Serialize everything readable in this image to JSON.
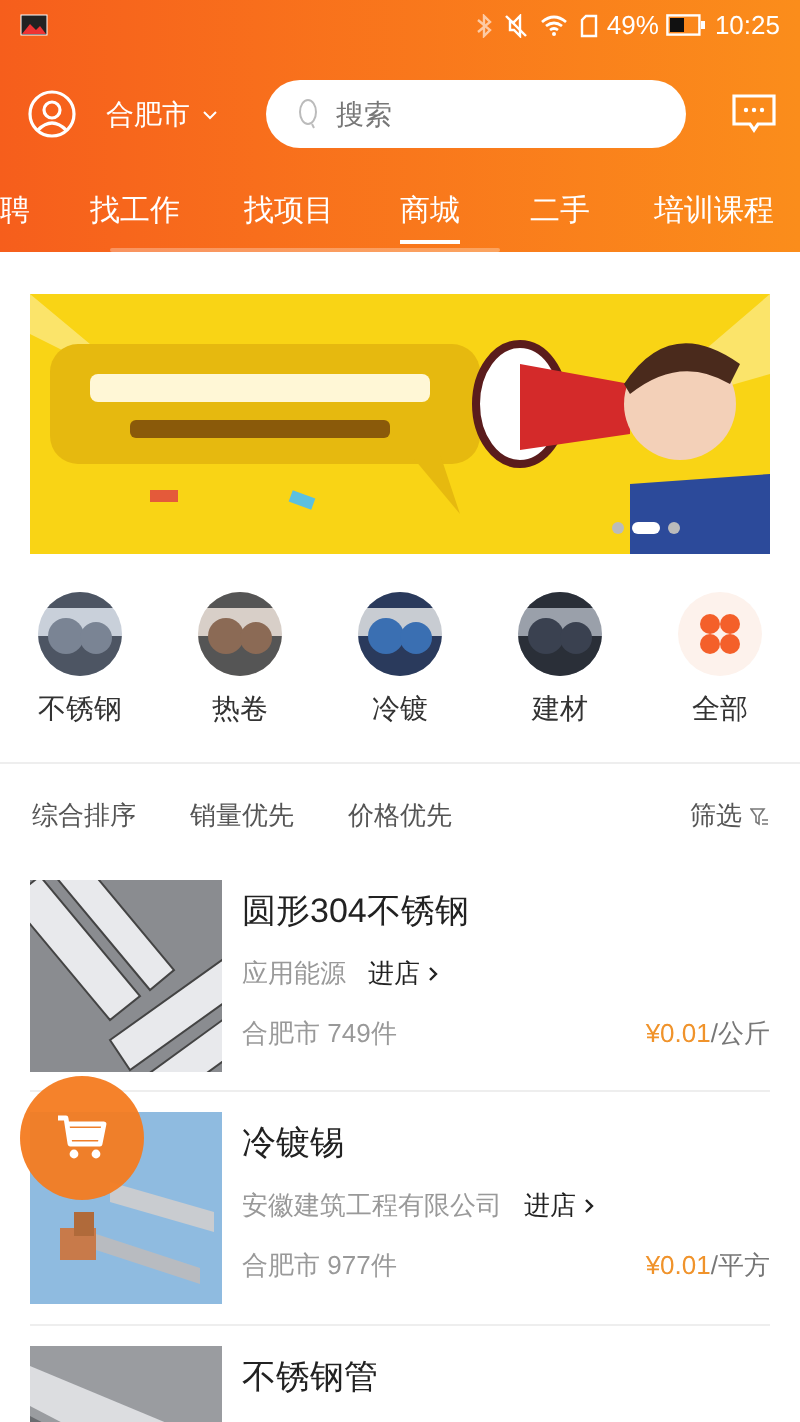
{
  "status_bar": {
    "battery": "49%",
    "time": "10:25"
  },
  "header": {
    "city": "合肥市",
    "search": {
      "placeholder": "搜索"
    }
  },
  "tabs": [
    {
      "label": "聘",
      "selected": false
    },
    {
      "label": "找工作",
      "selected": false
    },
    {
      "label": "找项目",
      "selected": false
    },
    {
      "label": "商城",
      "selected": true
    },
    {
      "label": "二手",
      "selected": false
    },
    {
      "label": "培训课程",
      "selected": false
    }
  ],
  "banner": {
    "kind": "picture",
    "slides": [
      {
        "selected": false
      },
      {
        "selected": true
      },
      {
        "selected": false
      }
    ]
  },
  "categories": [
    {
      "label": "不锈钢",
      "kind": "picture"
    },
    {
      "label": "热卷",
      "kind": "picture"
    },
    {
      "label": "冷镀",
      "kind": "picture"
    },
    {
      "label": "建材",
      "kind": "picture"
    },
    {
      "label": "全部",
      "kind": "icon"
    }
  ],
  "sort_bar": {
    "options": [
      "综合排序",
      "销量优先",
      "价格优先"
    ],
    "filter": "筛选"
  },
  "products": [
    {
      "name": "圆形304不锈钢",
      "shop": "应用能源",
      "shop_link": "进店",
      "location": "合肥市 749件",
      "price": "¥0.01",
      "unit": "/公斤"
    },
    {
      "name": "冷镀锡",
      "shop": "安徽建筑工程有限公司",
      "shop_link": "进店",
      "location": "合肥市 977件",
      "price": "¥0.01",
      "unit": "/平方"
    },
    {
      "name": "不锈钢管"
    }
  ]
}
